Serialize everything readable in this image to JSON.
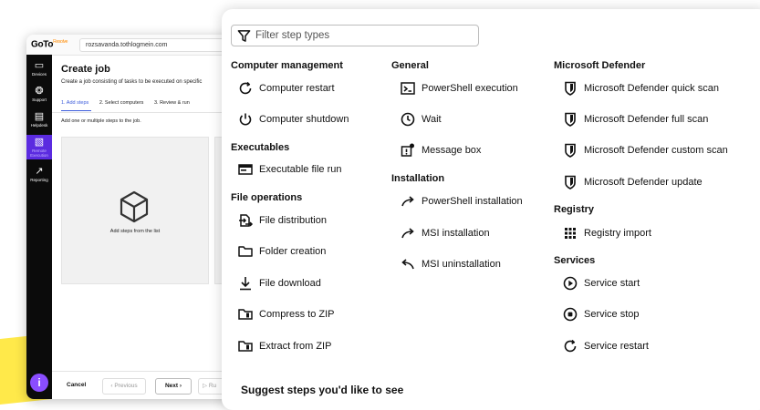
{
  "background_window": {
    "logo_text": "GoTo",
    "logo_sup": "Resolve",
    "url": "rozsavanda.tothlogmein.com",
    "rail": [
      {
        "label": "Devices",
        "icon": "devices-icon"
      },
      {
        "label": "Support",
        "icon": "support-icon"
      },
      {
        "label": "Helpdesk",
        "icon": "helpdesk-icon"
      },
      {
        "label": "Remote Execution",
        "icon": "remote-execution-icon"
      },
      {
        "label": "Reporting",
        "icon": "reporting-icon"
      }
    ],
    "info_label": "i",
    "title": "Create job",
    "subtitle": "Create a job consisting of tasks to be executed on specific",
    "steps": [
      "1. Add steps",
      "2. Select computers",
      "3. Review & run"
    ],
    "add_hint": "Add one or multiple steps to the job.",
    "drop_text": "Add steps from the list",
    "footer": {
      "cancel": "Cancel",
      "previous": "Previous",
      "next": "Next",
      "run": "Ru"
    }
  },
  "panel": {
    "filter_placeholder": "Filter step types",
    "columns": [
      {
        "sections": [
          {
            "title": "Computer management",
            "items": [
              {
                "label": "Computer restart",
                "icon": "restart-icon"
              },
              {
                "label": "Computer shutdown",
                "icon": "power-icon"
              }
            ]
          },
          {
            "title": "Executables",
            "items": [
              {
                "label": "Executable file run",
                "icon": "window-icon"
              }
            ]
          },
          {
            "title": "File operations",
            "items": [
              {
                "label": "File distribution",
                "icon": "file-distribution-icon"
              },
              {
                "label": "Folder creation",
                "icon": "folder-icon"
              },
              {
                "label": "File download",
                "icon": "download-icon"
              },
              {
                "label": "Compress to ZIP",
                "icon": "zip-icon"
              },
              {
                "label": "Extract from ZIP",
                "icon": "zip-icon"
              }
            ]
          }
        ]
      },
      {
        "sections": [
          {
            "title": "General",
            "items": [
              {
                "label": "PowerShell execution",
                "icon": "powershell-icon"
              },
              {
                "label": "Wait",
                "icon": "clock-icon"
              },
              {
                "label": "Message box",
                "icon": "message-box-icon"
              }
            ]
          },
          {
            "title": "Installation",
            "items": [
              {
                "label": "PowerShell installation",
                "icon": "install-arrow-icon"
              },
              {
                "label": "MSI installation",
                "icon": "install-arrow-icon"
              },
              {
                "label": "MSI uninstallation",
                "icon": "uninstall-arrow-icon"
              }
            ]
          }
        ]
      },
      {
        "sections": [
          {
            "title": "Microsoft Defender",
            "items": [
              {
                "label": "Microsoft Defender quick scan",
                "icon": "shield-icon"
              },
              {
                "label": "Microsoft Defender full scan",
                "icon": "shield-icon"
              },
              {
                "label": "Microsoft Defender custom scan",
                "icon": "shield-icon"
              },
              {
                "label": "Microsoft Defender update",
                "icon": "shield-icon"
              }
            ]
          },
          {
            "title": "Registry",
            "items": [
              {
                "label": "Registry import",
                "icon": "registry-grid-icon"
              }
            ]
          },
          {
            "title": "Services",
            "items": [
              {
                "label": "Service start",
                "icon": "play-circle-icon"
              },
              {
                "label": "Service stop",
                "icon": "stop-circle-icon"
              },
              {
                "label": "Service restart",
                "icon": "restart-icon"
              }
            ]
          }
        ]
      }
    ],
    "suggest_label": "Suggest steps you'd like to see"
  },
  "colors": {
    "accent": "#5b2be0",
    "link": "#3b5bdb",
    "highlight": "#ffe94a"
  }
}
